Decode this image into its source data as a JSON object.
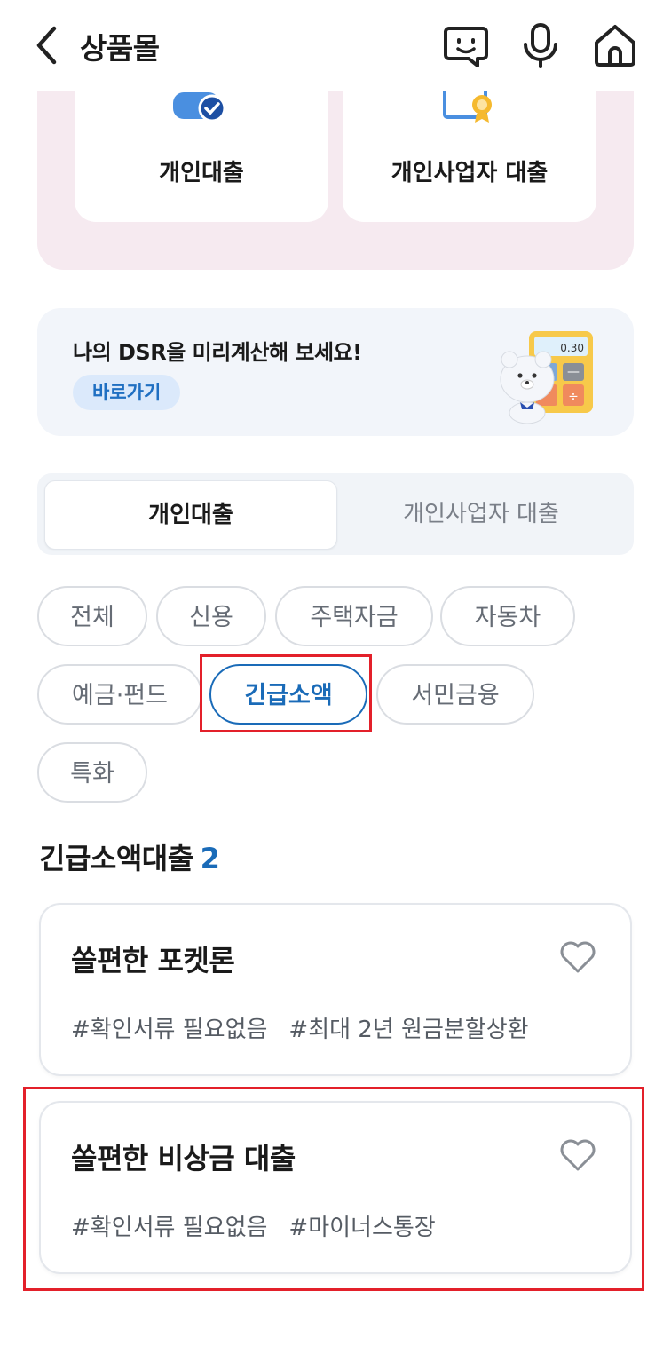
{
  "header": {
    "title": "상품몰"
  },
  "products": [
    {
      "label": "개인대출",
      "icon": "person-check-icon"
    },
    {
      "label": "개인사업자 대출",
      "icon": "certificate-icon"
    }
  ],
  "dsr_banner": {
    "title": "나의 DSR을 미리계산해 보세요!",
    "link_label": "바로가기",
    "calculator_display": "0.30"
  },
  "segment_tabs": [
    {
      "label": "개인대출",
      "active": true
    },
    {
      "label": "개인사업자 대출",
      "active": false
    }
  ],
  "chips": [
    {
      "label": "전체",
      "selected": false
    },
    {
      "label": "신용",
      "selected": false
    },
    {
      "label": "주택자금",
      "selected": false
    },
    {
      "label": "자동차",
      "selected": false
    },
    {
      "label": "예금·펀드",
      "selected": false
    },
    {
      "label": "긴급소액",
      "selected": true
    },
    {
      "label": "서민금융",
      "selected": false
    },
    {
      "label": "특화",
      "selected": false
    }
  ],
  "section": {
    "title": "긴급소액대출",
    "count": "2"
  },
  "loans": [
    {
      "name": "쏠편한 포켓론",
      "tags": [
        "#확인서류 필요없음",
        "#최대 2년 원금분할상환"
      ]
    },
    {
      "name": "쏠편한 비상금 대출",
      "tags": [
        "#확인서류 필요없음",
        "#마이너스통장"
      ]
    }
  ],
  "colors": {
    "accent": "#1a6bb8",
    "highlight": "#e3202a",
    "pink_bg": "#f6eaf0"
  }
}
